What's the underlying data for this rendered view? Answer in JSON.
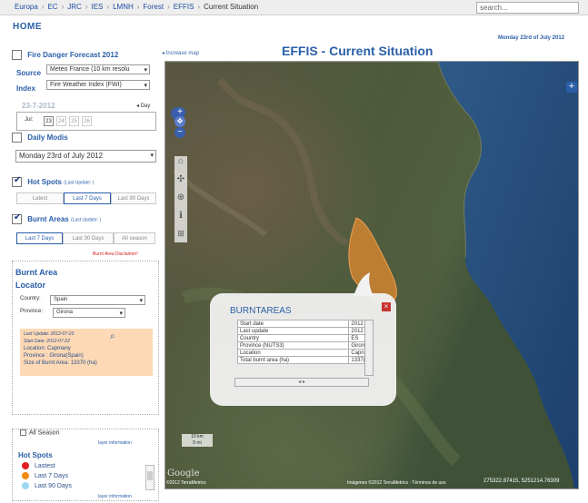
{
  "breadcrumb": [
    "Europa",
    "EC",
    "JRC",
    "IES",
    "LMNH",
    "Forest",
    "EFFIS",
    "Current Situation"
  ],
  "search": {
    "value": "search..."
  },
  "home_label": "HOME",
  "date_header": "Monday 23rd of July 2012",
  "page_title": "EFFIS - Current Situation",
  "increase_map": "Increase map",
  "fire_danger": {
    "label": "Fire Danger Forecast 2012",
    "source_label": "Source",
    "source_value": "Meteo France (10 km resolu",
    "index_label": "Index",
    "index_value": "Fire Weather Index (FWI)",
    "date": "23-7-2012",
    "day_label": "Day",
    "jul_label": "Jul:",
    "days": [
      "23",
      "24",
      "25",
      "26"
    ]
  },
  "daily_modis": {
    "label": "Daily Modis",
    "value": "Monday 23rd of July 2012"
  },
  "hot_spots": {
    "label": "Hot Spots",
    "update_note": "(Last Update: )",
    "tabs": [
      "Latest",
      "Last 7 Days",
      "Last 90 Days"
    ],
    "active_tab": 1
  },
  "burnt_areas": {
    "label": "Burnt Areas",
    "update_note": "(Last Update: )",
    "tabs": [
      "Last 7 Days",
      "Last 30 Days",
      "All season"
    ],
    "active_tab": 0,
    "disclaimer": "Burnt Area Disclaimer!"
  },
  "locator": {
    "title_line1": "Burnt Area",
    "title_line2": "Locator",
    "country_label": "Country:",
    "country_value": "Spain",
    "province_label": "Province:",
    "province_value": "Girona",
    "result": {
      "last_update": "Last Update: 2012-07-23",
      "start_date": "Start Date: 2012-07-22",
      "location": "Location: Capmany",
      "province": "Province : Girona(Spain)",
      "size": "Size of Burnt Area: 13370 (ha)"
    }
  },
  "layers": {
    "all_season": "All Season",
    "layer_info": "layer information",
    "hot_spots_title": "Hot Spots",
    "legend": [
      {
        "label": "Lastest",
        "color": "#e02020"
      },
      {
        "label": "Last 7 Days",
        "color": "#f08a10"
      },
      {
        "label": "Last 90 Days",
        "color": "#9ad8ee"
      }
    ],
    "layer_info_2": "layer information"
  },
  "map": {
    "popup_title": "BURNTAREAS",
    "popup_rows": [
      {
        "key": "Start date",
        "value": "2012"
      },
      {
        "key": "Last update",
        "value": "2012"
      },
      {
        "key": "Country",
        "value": "ES"
      },
      {
        "key": "Province (NUTS3)",
        "value": "Giron"
      },
      {
        "key": "Location",
        "value": "Capn"
      },
      {
        "key": "Total burnt area (ha)",
        "value": "1337("
      }
    ],
    "scale_km": "10 km",
    "scale_mi": "5 mi",
    "attribution_left": "©2012 TerraMetrics",
    "attribution_right": "Imágenes ©2012 TerraMetrics · Términos de uso",
    "coords": "275322.87415, 5251214.76309",
    "google": "Google",
    "accent_burnt": "#e08a30"
  }
}
